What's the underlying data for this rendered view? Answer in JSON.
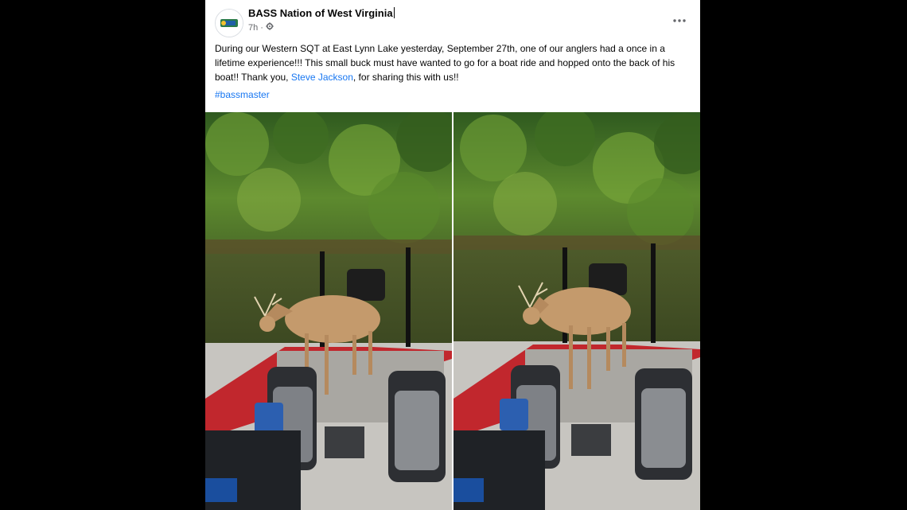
{
  "post": {
    "page_name": "BASS Nation of West Virginia",
    "timestamp": "7h",
    "separator": "·",
    "audience_icon": "gear-icon",
    "more_icon": "more-options-icon",
    "caption_part1": "During our Western SQT at East Lynn Lake yesterday, September 27th, one of our anglers had a once in a lifetime experience!!! This small buck must have wanted to go for a boat ride and hopped onto the back of his boat!!  Thank you, ",
    "mention": "Steve Jackson",
    "caption_part2": ", for sharing this with us!!",
    "hashtag": "#bassmaster"
  },
  "photos": [
    {
      "alt": "photo-1"
    },
    {
      "alt": "photo-2"
    }
  ],
  "colors": {
    "link": "#1877f2",
    "text": "#050505",
    "meta": "#65676b",
    "background": "#000000"
  }
}
